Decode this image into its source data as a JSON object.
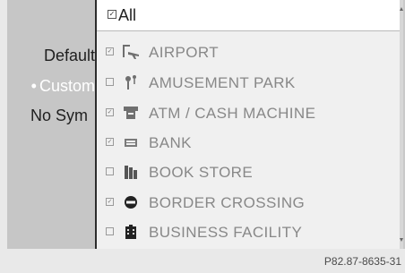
{
  "left_panel": {
    "options": [
      {
        "label": "Default",
        "selected": false
      },
      {
        "label": "Custom",
        "selected": true
      },
      {
        "label": "No Sym",
        "selected": false
      }
    ]
  },
  "dropdown": {
    "header": {
      "label": "All",
      "checked": true
    },
    "items": [
      {
        "label": "AIRPORT",
        "checked": true,
        "icon": "airport-icon"
      },
      {
        "label": "AMUSEMENT PARK",
        "checked": false,
        "icon": "amusement-park-icon"
      },
      {
        "label": "ATM / CASH MACHINE",
        "checked": true,
        "icon": "atm-icon"
      },
      {
        "label": "BANK",
        "checked": true,
        "icon": "bank-icon"
      },
      {
        "label": "BOOK STORE",
        "checked": false,
        "icon": "book-store-icon"
      },
      {
        "label": "BORDER CROSSING",
        "checked": true,
        "icon": "border-crossing-icon"
      },
      {
        "label": "BUSINESS FACILITY",
        "checked": false,
        "icon": "business-facility-icon"
      }
    ]
  },
  "reference_code": "P82.87-8635-31",
  "colors": {
    "item_text": "#888888",
    "header_text": "#222222",
    "selected_left_option": "#ffffff"
  }
}
